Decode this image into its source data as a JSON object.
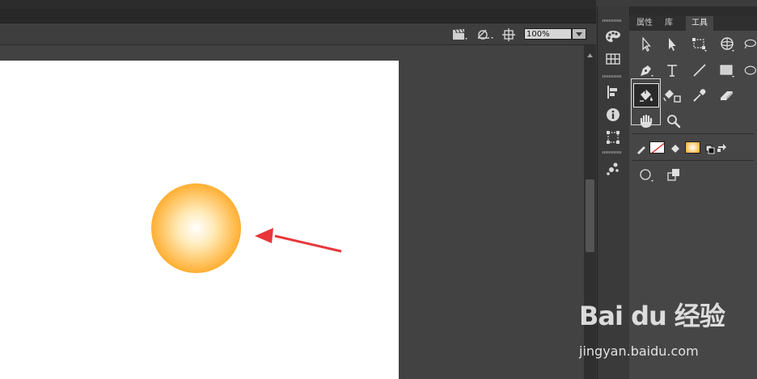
{
  "edit_bar": {
    "zoom": {
      "value": "100%",
      "icon": "chevron-down-icon"
    },
    "icons": [
      "clapperboard-icon",
      "symbol-transform-icon",
      "center-stage-icon"
    ]
  },
  "stage": {
    "shape": {
      "type": "radial-gradient-circle",
      "gradient_colors": [
        "#ffffff",
        "#ffeab8",
        "#ffa41a",
        "#ff9a00"
      ]
    },
    "annotation_arrow_color": "#e8363a"
  },
  "dock": {
    "icons": [
      "color-palette-icon",
      "swatches-grid-icon",
      "align-icon",
      "info-icon",
      "transform-icon",
      "components-icon"
    ],
    "collapse_glyph": "««"
  },
  "panel": {
    "tabs": [
      {
        "label": "属性",
        "active": false
      },
      {
        "label": "库",
        "active": false
      },
      {
        "label": "工具",
        "active": true
      }
    ],
    "tools": [
      "selection-arrow-icon",
      "subselection-arrow-icon",
      "free-transform-icon",
      "3d-rotation-icon",
      "lasso-icon",
      "pen-icon",
      "text-tool-icon",
      "line-tool-icon",
      "rectangle-tool-icon",
      "oval-tool-icon",
      "paint-bucket-icon",
      "ink-bottle-icon",
      "eyedropper-icon",
      "eraser-icon",
      "hand-tool-icon",
      "zoom-tool-icon"
    ],
    "selected_tool": "paint-bucket-icon",
    "colors": {
      "stroke": "none",
      "fill_gradient": [
        "#ffffff",
        "#ffa41a"
      ]
    },
    "options": [
      "object-drawing-icon",
      "snap-icon"
    ]
  },
  "watermark": {
    "logo": "Bai du 经验",
    "url": "jingyan.baidu.com"
  }
}
